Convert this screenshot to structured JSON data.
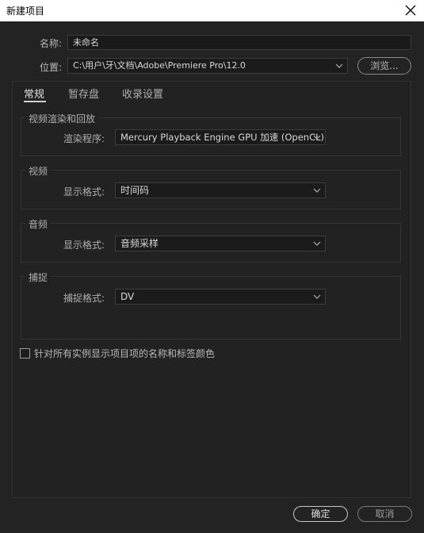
{
  "window": {
    "title": "新建项目"
  },
  "name": {
    "label": "名称:",
    "value": "未命名"
  },
  "location": {
    "label": "位置:",
    "value": "C:\\用户\\牙\\文档\\Adobe\\Premiere Pro\\12.0",
    "browse_label": "浏览..."
  },
  "tabs": [
    {
      "label": "常规",
      "active": true
    },
    {
      "label": "暂存盘",
      "active": false
    },
    {
      "label": "收录设置",
      "active": false
    }
  ],
  "groups": {
    "render": {
      "title": "视频渲染和回放",
      "field_label": "渲染程序:",
      "value": "Mercury Playback Engine GPU 加速 (OpenCL)"
    },
    "video": {
      "title": "视频",
      "field_label": "显示格式:",
      "value": "时间码"
    },
    "audio": {
      "title": "音频",
      "field_label": "显示格式:",
      "value": "音频采样"
    },
    "capture": {
      "title": "捕捉",
      "field_label": "捕捉格式:",
      "value": "DV"
    }
  },
  "checkbox": {
    "label": "针对所有实例显示项目项的名称和标签颜色",
    "checked": false
  },
  "footer": {
    "ok_label": "确定",
    "cancel_label": "取消"
  }
}
